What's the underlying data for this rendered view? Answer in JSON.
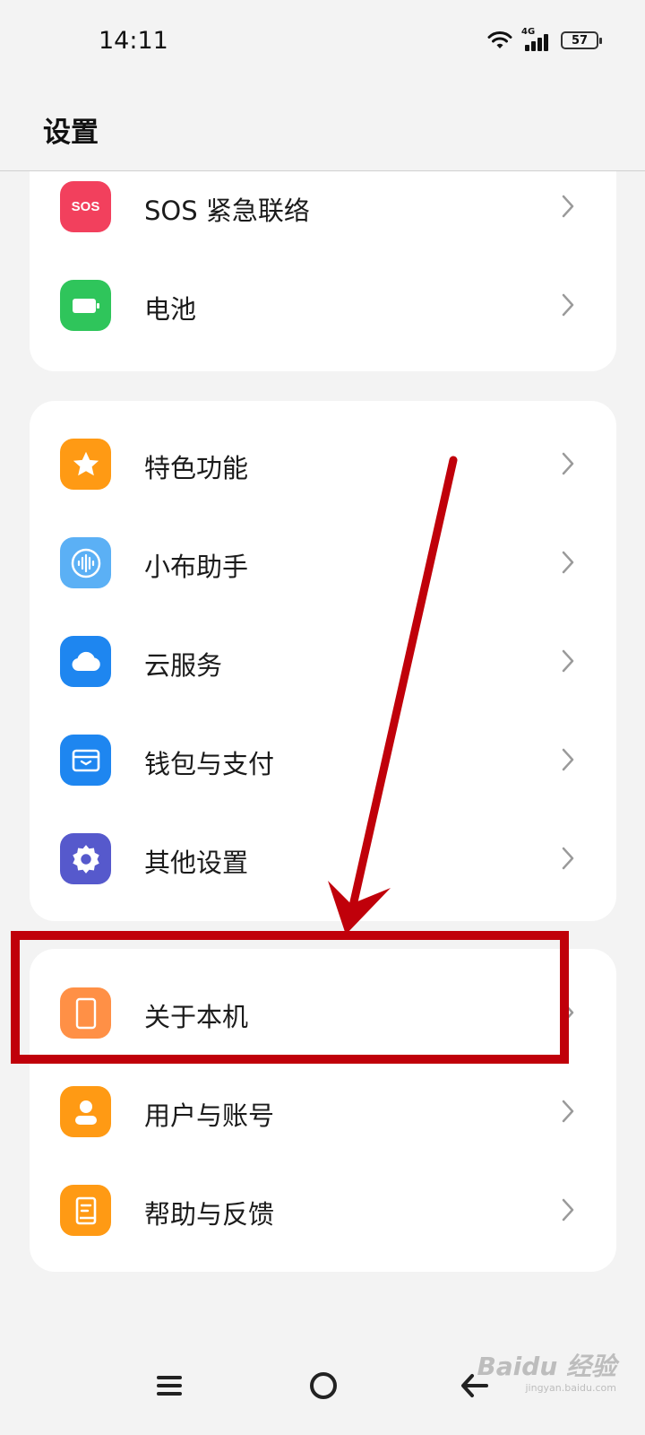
{
  "status_bar": {
    "time": "14:11",
    "network": "4G",
    "battery_level": "57"
  },
  "header": {
    "title": "设置"
  },
  "sections": [
    {
      "items": [
        {
          "label": "SOS 紧急联络",
          "icon": "sos-icon",
          "icon_text": "SOS",
          "color": "#f2405d"
        },
        {
          "label": "电池",
          "icon": "battery-icon",
          "color": "#2fc55b"
        }
      ]
    },
    {
      "items": [
        {
          "label": "特色功能",
          "icon": "star-icon",
          "color": "#ff9a14"
        },
        {
          "label": "小布助手",
          "icon": "voice-wave-icon",
          "color": "#5bb0f5"
        },
        {
          "label": "云服务",
          "icon": "cloud-icon",
          "color": "#1e86f0"
        },
        {
          "label": "钱包与支付",
          "icon": "wallet-icon",
          "color": "#1e86f0"
        },
        {
          "label": "其他设置",
          "icon": "gear-icon",
          "color": "#5659cc"
        }
      ]
    },
    {
      "items": [
        {
          "label": "关于本机",
          "icon": "phone-icon",
          "color": "#ff9046"
        },
        {
          "label": "用户与账号",
          "icon": "user-icon",
          "color": "#ff9a14"
        },
        {
          "label": "帮助与反馈",
          "icon": "help-book-icon",
          "color": "#ff9a14"
        }
      ]
    }
  ],
  "annotation": {
    "highlight_color": "#c0000a"
  },
  "watermark": {
    "main": "Baidu 经验",
    "sub": "jingyan.baidu.com"
  }
}
